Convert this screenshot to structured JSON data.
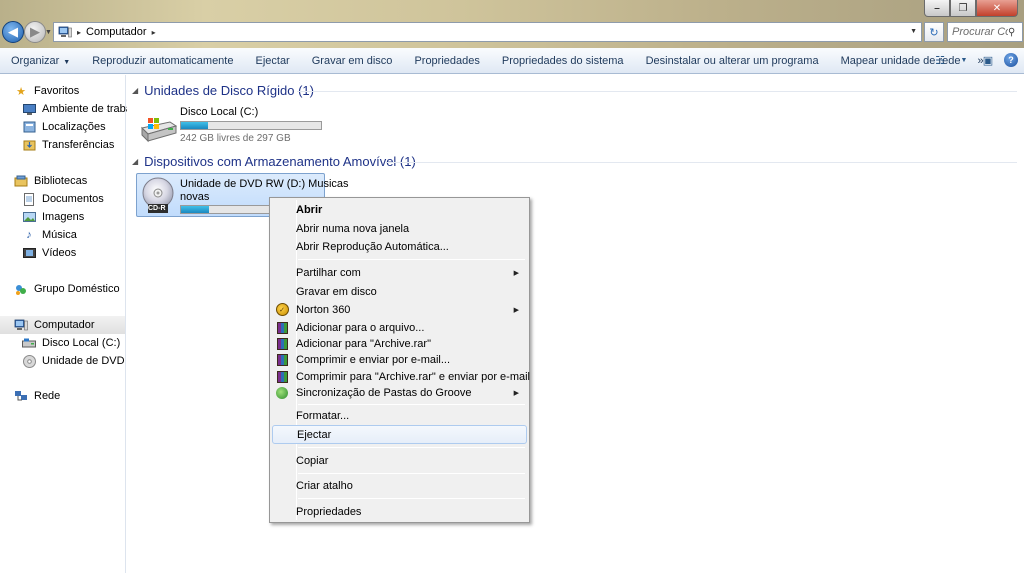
{
  "window": {
    "controls": {
      "minimize": "–",
      "maximize": "❐",
      "close": "✕"
    }
  },
  "address": {
    "root_glyph": "▸",
    "crumb": "Computador",
    "separator": "▸",
    "dropdown": "▼",
    "search_placeholder": "Procurar Co...",
    "refresh_glyph": "↻"
  },
  "commands": [
    {
      "label": "Organizar",
      "has_menu": true
    },
    {
      "label": "Reproduzir automaticamente"
    },
    {
      "label": "Ejectar"
    },
    {
      "label": "Gravar em disco"
    },
    {
      "label": "Propriedades"
    },
    {
      "label": "Propriedades do sistema"
    },
    {
      "label": "Desinstalar ou alterar um programa"
    },
    {
      "label": "Mapear unidade de rede"
    }
  ],
  "command_more": "»",
  "nav": {
    "favorites": "Favoritos",
    "desktop": "Ambiente de trabalho",
    "locations": "Localizações",
    "downloads": "Transferências",
    "libraries": "Bibliotecas",
    "documents": "Documentos",
    "images": "Imagens",
    "music": "Música",
    "videos": "Vídeos",
    "homegroup": "Grupo Doméstico",
    "computer": "Computador",
    "local_disk": "Disco Local (C:)",
    "dvd_drive": "Unidade de DVD RW (",
    "network": "Rede"
  },
  "groups": {
    "hard_disks": "Unidades de Disco Rígido (1)",
    "removable": "Dispositivos com Armazenamento Amovível (1)"
  },
  "drives": {
    "c": {
      "name": "Disco Local (C:)",
      "free_text": "242 GB livres de 297 GB",
      "used_fraction": 0.19
    },
    "d": {
      "name_line1": "Unidade de DVD RW (D:) Musicas",
      "name_line2": "novas",
      "used_fraction": 0.2,
      "badge": "CD-R"
    }
  },
  "context_menu": {
    "open": "Abrir",
    "open_new_window": "Abrir numa nova janela",
    "open_autoplay": "Abrir Reprodução Automática...",
    "share_with": "Partilhar com",
    "burn": "Gravar em disco",
    "norton": "Norton 360",
    "add_to_archive": "Adicionar para o arquivo...",
    "add_to_rar": "Adicionar para \"Archive.rar\"",
    "compress_email": "Comprimir e enviar por e-mail...",
    "compress_rar_email": "Comprimir para \"Archive.rar\" e enviar por e-mail",
    "groove_sync": "Sincronização de Pastas do Groove",
    "format": "Formatar...",
    "eject": "Ejectar",
    "copy": "Copiar",
    "create_shortcut": "Criar atalho",
    "properties": "Propriedades",
    "submenu_arrow": "▶"
  }
}
